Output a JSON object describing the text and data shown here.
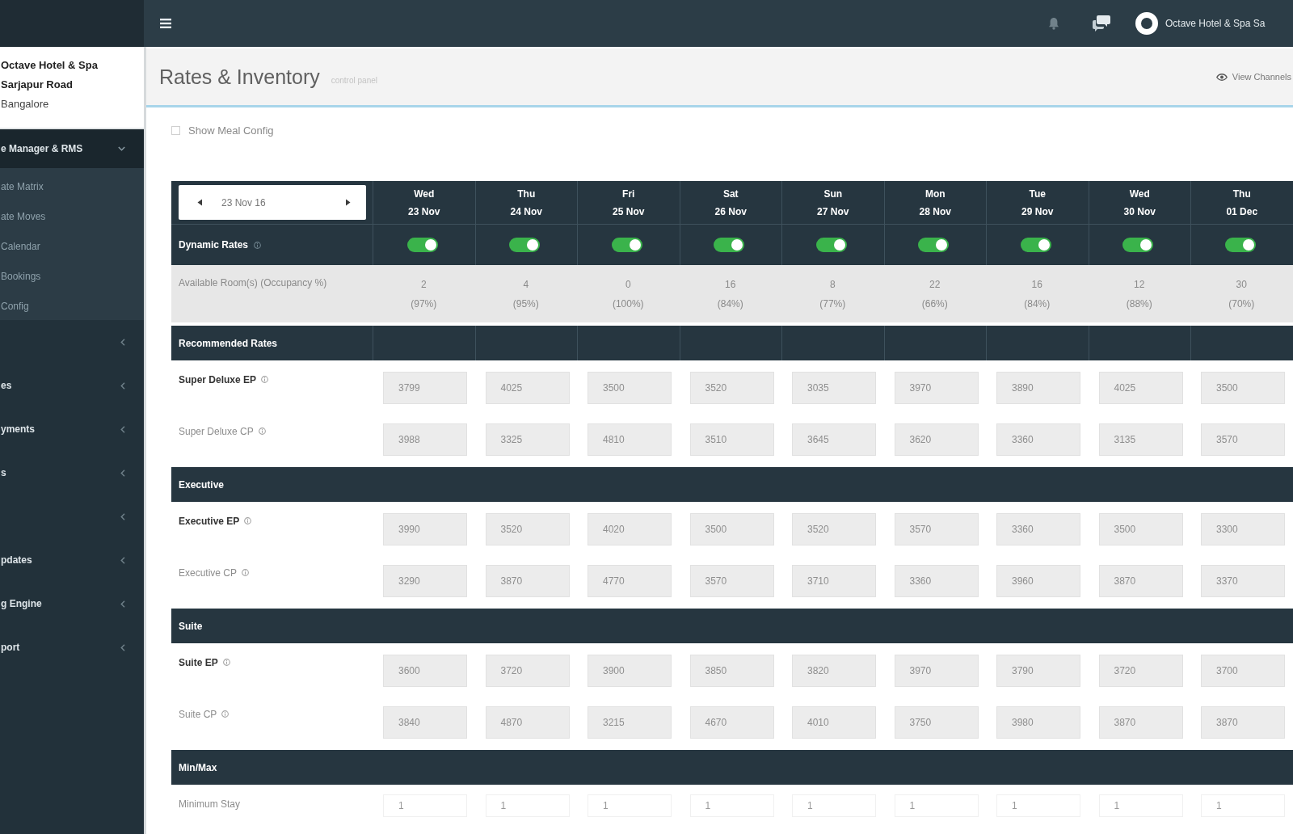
{
  "top_bar": {
    "user_name": "Octave Hotel & Spa Sa"
  },
  "sidebar": {
    "hotel": {
      "name": "Octave Hotel & Spa",
      "area": "Sarjapur Road",
      "city": "Bangalore"
    },
    "menu": [
      {
        "label": "e Manager & RMS",
        "expanded": true,
        "children": [
          {
            "label": "ate Matrix",
            "selected": false
          },
          {
            "label": "ate Moves",
            "selected": false
          },
          {
            "label": "Calendar",
            "selected": false
          },
          {
            "label": "Bookings",
            "selected": false
          },
          {
            "label": "Config",
            "selected": false
          }
        ]
      },
      {
        "expanded": false
      },
      {
        "label": "es",
        "expanded": false
      },
      {
        "label": "yments",
        "expanded": false
      },
      {
        "label": "s",
        "expanded": false
      },
      {
        "expanded": false
      },
      {
        "label": "pdates",
        "expanded": false
      },
      {
        "label": "g Engine",
        "expanded": false
      },
      {
        "label": "port",
        "expanded": false
      }
    ]
  },
  "page": {
    "title": "Rates & Inventory",
    "subtitle": "control panel",
    "action": "View Channels"
  },
  "filters": {
    "meal_config": {
      "label": "Show Meal Config",
      "checked": false
    }
  },
  "grid": {
    "date_picker": {
      "value": "23 Nov 16"
    },
    "days": [
      {
        "weekday": "Wed",
        "date": "23 Nov"
      },
      {
        "weekday": "Thu",
        "date": "24 Nov"
      },
      {
        "weekday": "Fri",
        "date": "25 Nov"
      },
      {
        "weekday": "Sat",
        "date": "26 Nov"
      },
      {
        "weekday": "Sun",
        "date": "27 Nov"
      },
      {
        "weekday": "Mon",
        "date": "28 Nov"
      },
      {
        "weekday": "Tue",
        "date": "29 Nov"
      },
      {
        "weekday": "Wed",
        "date": "30 Nov"
      },
      {
        "weekday": "Thu",
        "date": "01 Dec"
      }
    ],
    "dynamic_rates": {
      "label": "Dynamic Rates",
      "toggles": [
        {
          "on": true
        },
        {
          "on": true
        },
        {
          "on": true
        },
        {
          "on": true
        },
        {
          "on": true
        },
        {
          "on": true
        },
        {
          "on": true
        },
        {
          "on": true
        },
        {
          "on": true
        }
      ]
    },
    "availability": {
      "label": "Available Room(s) (Occupancy %)",
      "cells": [
        {
          "rooms": "2",
          "occupancy": "(97%)"
        },
        {
          "rooms": "4",
          "occupancy": "(95%)"
        },
        {
          "rooms": "0",
          "occupancy": "(100%)"
        },
        {
          "rooms": "16",
          "occupancy": "(84%)"
        },
        {
          "rooms": "8",
          "occupancy": "(77%)"
        },
        {
          "rooms": "22",
          "occupancy": "(66%)"
        },
        {
          "rooms": "16",
          "occupancy": "(84%)"
        },
        {
          "rooms": "12",
          "occupancy": "(88%)"
        },
        {
          "rooms": "30",
          "occupancy": "(70%)"
        }
      ]
    },
    "sections": [
      {
        "title": "Recommended Rates",
        "column_dividers": true,
        "rows": [
          {
            "label": "Super Deluxe EP",
            "kind": "primary",
            "values": [
              "3799",
              "4025",
              "3500",
              "3520",
              "3035",
              "3970",
              "3890",
              "4025",
              "3500"
            ]
          },
          {
            "label": "Super Deluxe CP",
            "kind": "secondary",
            "values": [
              "3988",
              "3325",
              "4810",
              "3510",
              "3645",
              "3620",
              "3360",
              "3135",
              "3570"
            ]
          }
        ]
      },
      {
        "title": "Executive",
        "column_dividers": false,
        "rows": [
          {
            "label": "Executive EP",
            "kind": "primary",
            "values": [
              "3990",
              "3520",
              "4020",
              "3500",
              "3520",
              "3570",
              "3360",
              "3500",
              "3300"
            ]
          },
          {
            "label": "Executive CP",
            "kind": "secondary",
            "values": [
              "3290",
              "3870",
              "4770",
              "3570",
              "3710",
              "3360",
              "3960",
              "3870",
              "3370"
            ]
          }
        ]
      },
      {
        "title": "Suite",
        "column_dividers": false,
        "rows": [
          {
            "label": "Suite EP",
            "kind": "primary",
            "values": [
              "3600",
              "3720",
              "3900",
              "3850",
              "3820",
              "3970",
              "3790",
              "3720",
              "3700"
            ]
          },
          {
            "label": "Suite CP",
            "kind": "secondary",
            "values": [
              "3840",
              "4870",
              "3215",
              "4670",
              "4010",
              "3750",
              "3980",
              "3870",
              "3870"
            ]
          }
        ]
      },
      {
        "title": "Min/Max",
        "column_dividers": false,
        "rows": [
          {
            "label": "Minimum Stay",
            "kind": "plain",
            "values": [
              "1",
              "1",
              "1",
              "1",
              "1",
              "1",
              "1",
              "1",
              "1"
            ]
          }
        ]
      }
    ]
  }
}
